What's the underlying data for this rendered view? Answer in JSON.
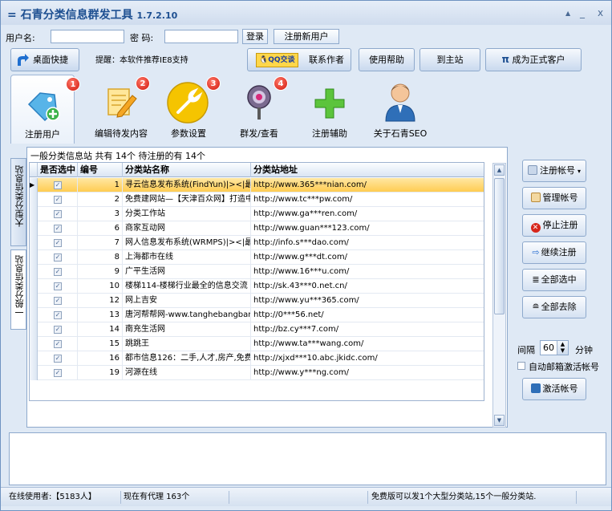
{
  "window": {
    "title": "石青分类信息群发工具",
    "version": "1.7.2.10",
    "menu_glyph": "=",
    "btn_pin": "▲",
    "btn_min": "_",
    "btn_close": "x"
  },
  "login": {
    "username_label": "用户名:",
    "username_value": "",
    "password_label": "密  码:",
    "password_value": "",
    "login_button": "登录",
    "register_button": "注册新用户"
  },
  "toolbar": {
    "desktop_shortcut": "桌面快捷",
    "tip": "提醒：本软件推荐IE8支持",
    "qq_badge": "QQ交谈",
    "contact_author": "联系作者",
    "help": "使用帮助",
    "to_site": "到主站",
    "pi_glyph": "π",
    "become_customer": "成为正式客户"
  },
  "big_buttons": [
    {
      "label": "注册用户",
      "badge": "1",
      "icon": "tag-add-icon"
    },
    {
      "label": "编辑待发内容",
      "badge": "2",
      "icon": "edit-pencil-icon"
    },
    {
      "label": "参数设置",
      "badge": "3",
      "icon": "wrench-icon"
    },
    {
      "label": "群发/查看",
      "badge": "4",
      "icon": "broadcast-icon"
    },
    {
      "label": "注册辅助",
      "badge": "",
      "icon": "plus-icon"
    },
    {
      "label": "关于石青SEO",
      "badge": "",
      "icon": "person-icon"
    }
  ],
  "side_tabs": {
    "tab_large": "大型分类信息站",
    "tab_general": "一般分类信息站"
  },
  "grid": {
    "group_label": "一般分类信息站 共有 14个 待注册的有 14个",
    "columns": [
      "是否选中",
      "编号",
      "分类站名称",
      "分类站地址"
    ],
    "rows": [
      {
        "check": "✓",
        "id": "1",
        "name": "寻云信息发布系统(FindYun)|><|最专",
        "url": "http://www.365***nian.com/"
      },
      {
        "check": "✓",
        "id": "2",
        "name": "免费建网站—【天津百众网】打造中",
        "url": "http://www.tc***pw.com/"
      },
      {
        "check": "✓",
        "id": "3",
        "name": "分类工作站",
        "url": "http://www.ga***ren.com/"
      },
      {
        "check": "✓",
        "id": "6",
        "name": "商家互动网",
        "url": "http://www.guan***123.com/"
      },
      {
        "check": "✓",
        "id": "7",
        "name": "网人信息发布系统(WRMPS)|><|最专",
        "url": "http://info.s***dao.com/"
      },
      {
        "check": "✓",
        "id": "8",
        "name": "上海都市在线",
        "url": "http://www.g***dt.com/"
      },
      {
        "check": "✓",
        "id": "9",
        "name": "广平生活网",
        "url": "http://www.16***u.com/"
      },
      {
        "check": "✓",
        "id": "10",
        "name": "楼梯114-楼梯行业最全的信息交流",
        "url": "http://sk.43***0.net.cn/"
      },
      {
        "check": "✓",
        "id": "12",
        "name": "网上吉安",
        "url": "http://www.yu***365.com/"
      },
      {
        "check": "✓",
        "id": "13",
        "name": "唐河帮帮网-www.tanghebangbang",
        "url": "http://0***56.net/"
      },
      {
        "check": "✓",
        "id": "14",
        "name": "南充生活网",
        "url": "http://bz.cy***7.com/"
      },
      {
        "check": "✓",
        "id": "15",
        "name": "跳跳王",
        "url": "http://www.ta***wang.com/"
      },
      {
        "check": "✓",
        "id": "16",
        "name": "都市信息126：二手,人才,房产,免费",
        "url": "http://xjxd***10.abc.jkidc.com/"
      },
      {
        "check": "✓",
        "id": "19",
        "name": "河源在线",
        "url": "http://www.y***ng.com/"
      }
    ]
  },
  "actions": {
    "register_account": "注册帐号",
    "manage_account": "管理帐号",
    "stop_register": "停止注册",
    "continue_register": "继续注册",
    "select_all": "全部选中",
    "deselect_all": "全部去除",
    "interval_label": "间隔",
    "interval_value": "60",
    "interval_unit": "分钟",
    "auto_email_label": "自动邮箱激活帐号",
    "activate_account": "激活帐号"
  },
  "status": {
    "online_users": "在线使用者:【5183人】",
    "proxies": "现在有代理 163个",
    "free_notice": "免费版可以发1个大型分类站,15个一般分类站."
  },
  "colors": {
    "accent": "#1d4f91",
    "selected_row": "#ffcc52",
    "badge": "#d0150a"
  }
}
